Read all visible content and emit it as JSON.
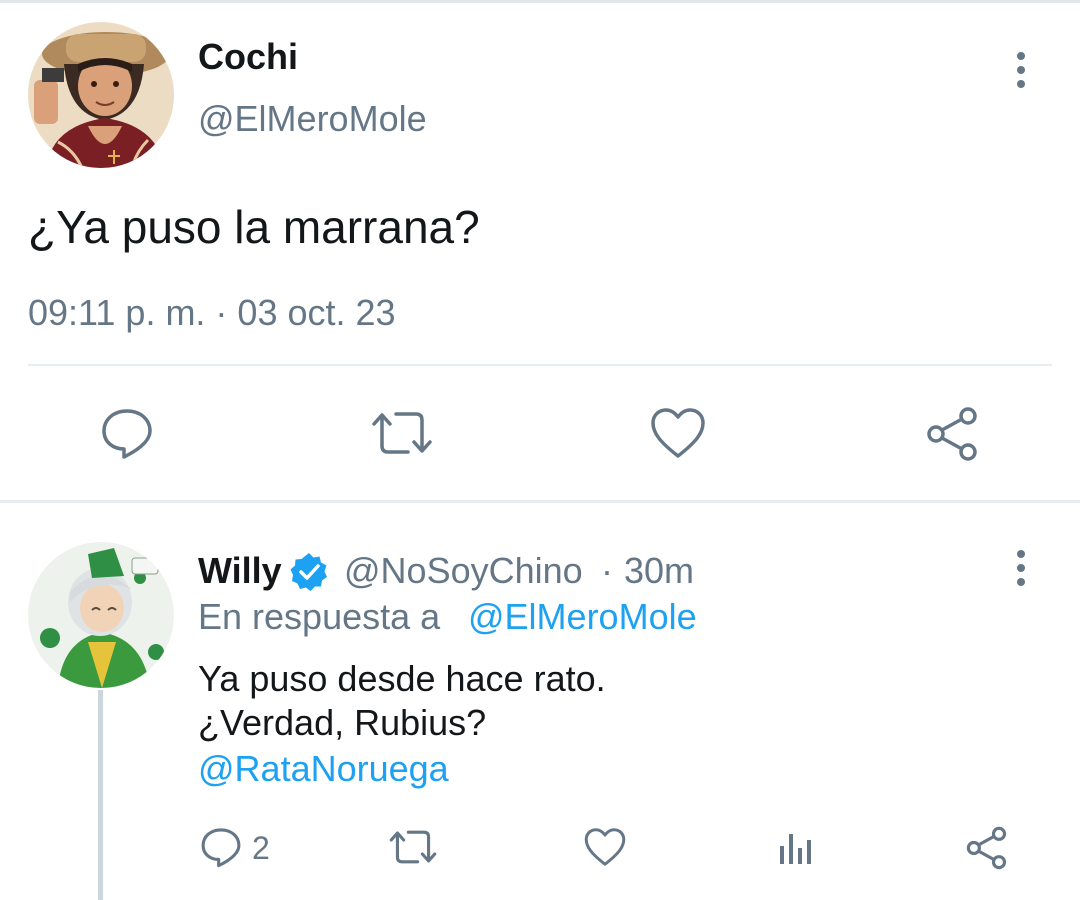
{
  "main_tweet": {
    "display_name": "Cochi",
    "handle": "@ElMeroMole",
    "text": "¿Ya puso la marrana?",
    "timestamp": "09:11 p. m. · 03 oct. 23",
    "actions": [
      {
        "icon": "reply-icon"
      },
      {
        "icon": "retweet-icon"
      },
      {
        "icon": "like-icon"
      },
      {
        "icon": "share-icon"
      }
    ]
  },
  "reply_tweet": {
    "display_name": "Willy",
    "verified": true,
    "handle": "@NoSoyChino",
    "separator": "·",
    "time_ago": "30m",
    "reply_prefix": "En respuesta a",
    "reply_to": "@ElMeroMole",
    "text_line1": "Ya puso desde hace rato.",
    "text_line2": "¿Verdad, Rubius?",
    "mention": "@RataNoruega",
    "reply_count": "2",
    "actions": [
      {
        "icon": "reply-icon"
      },
      {
        "icon": "retweet-icon"
      },
      {
        "icon": "like-icon"
      },
      {
        "icon": "analytics-icon"
      },
      {
        "icon": "share-icon"
      }
    ]
  },
  "colors": {
    "text": "#14171a",
    "secondary": "#657786",
    "link": "#1da1f2",
    "verified": "#1da1f2",
    "divider": "#e6ecf0"
  }
}
